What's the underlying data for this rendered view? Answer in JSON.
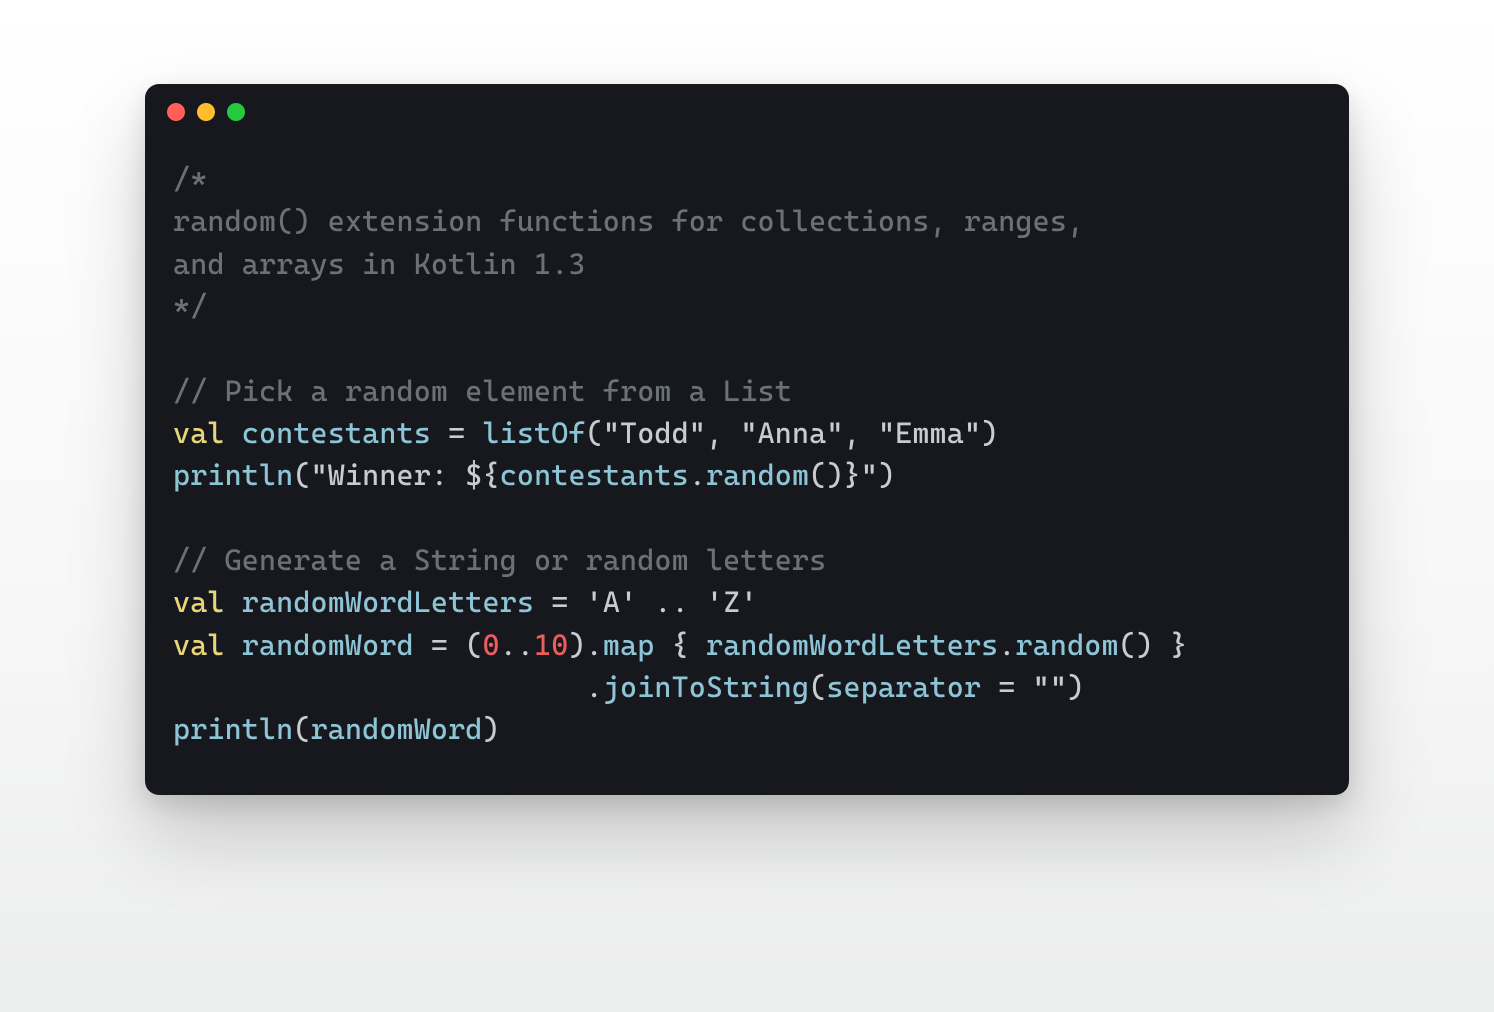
{
  "window": {
    "dot_colors": {
      "red": "#ff5f56",
      "yellow": "#ffbd2e",
      "green": "#27c93f"
    }
  },
  "code": {
    "block_comment": {
      "open": "/*",
      "l1": "random() extension functions for collections, ranges,",
      "l2": "and arrays in Kotlin 1.3",
      "close": "*/"
    },
    "c1": "// Pick a random element from a List",
    "kw_val": "val",
    "id_contestants": "contestants",
    "eq": " = ",
    "fn_listOf": "listOf",
    "paren_open": "(",
    "paren_close": ")",
    "comma_sp": ", ",
    "str_todd": "\"Todd\"",
    "str_anna": "\"Anna\"",
    "str_emma": "\"Emma\"",
    "fn_println": "println",
    "str_winner_open": "\"Winner: ",
    "interp_open": "${",
    "interp_close": "}",
    "id_contestants2": "contestants",
    "dot": ".",
    "fn_random": "random",
    "empty_call": "()",
    "str_close_quote": "\"",
    "c2": "// Generate a String or random letters",
    "id_randomWordLetters": "randomWordLetters",
    "char_A": "'A'",
    "range_op_sp": " .. ",
    "char_Z": "'Z'",
    "id_randomWord": "randomWord",
    "num_0": "0",
    "range_op": "..",
    "num_10": "10",
    "fn_map": "map",
    "brace_open": " { ",
    "brace_close": " }",
    "id_randomWordLetters2": "randomWordLetters",
    "indent_join": "                        ",
    "fn_joinToString": "joinToString",
    "id_separator": "separator",
    "eq2": " = ",
    "str_empty": "\"\""
  }
}
